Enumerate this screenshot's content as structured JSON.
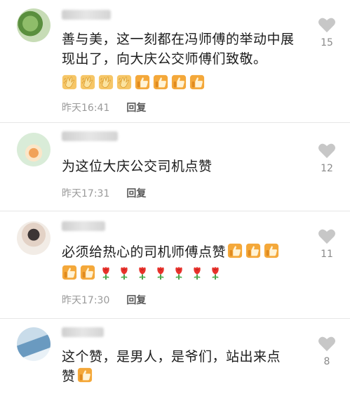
{
  "comments": [
    {
      "text": "善与美，这一刻都在冯师傅的举动中展现出了，向大庆公交师傅们致敬。",
      "time": "昨天16:41",
      "reply": "回复",
      "likes": "15",
      "emojis": [
        "clap-icon",
        "clap-icon",
        "clap-icon",
        "clap-icon",
        "thumbs-up-icon",
        "thumbs-up-icon",
        "thumbs-up-icon",
        "thumbs-up-icon"
      ]
    },
    {
      "text": "为这位大庆公交司机点赞",
      "time": "昨天17:31",
      "reply": "回复",
      "likes": "12"
    },
    {
      "text": "必须给热心的司机师傅点赞",
      "time": "昨天17:30",
      "reply": "回复",
      "likes": "11",
      "emojis": [
        "thumbs-up-icon",
        "thumbs-up-icon",
        "thumbs-up-icon",
        "thumbs-up-icon",
        "thumbs-up-icon",
        "rose-icon",
        "rose-icon",
        "rose-icon",
        "rose-icon",
        "rose-icon",
        "rose-icon",
        "rose-icon"
      ]
    },
    {
      "text_line1": "这个赞，是男人，是爷们，站出来点",
      "text_line2": "赞",
      "likes": "8"
    }
  ]
}
